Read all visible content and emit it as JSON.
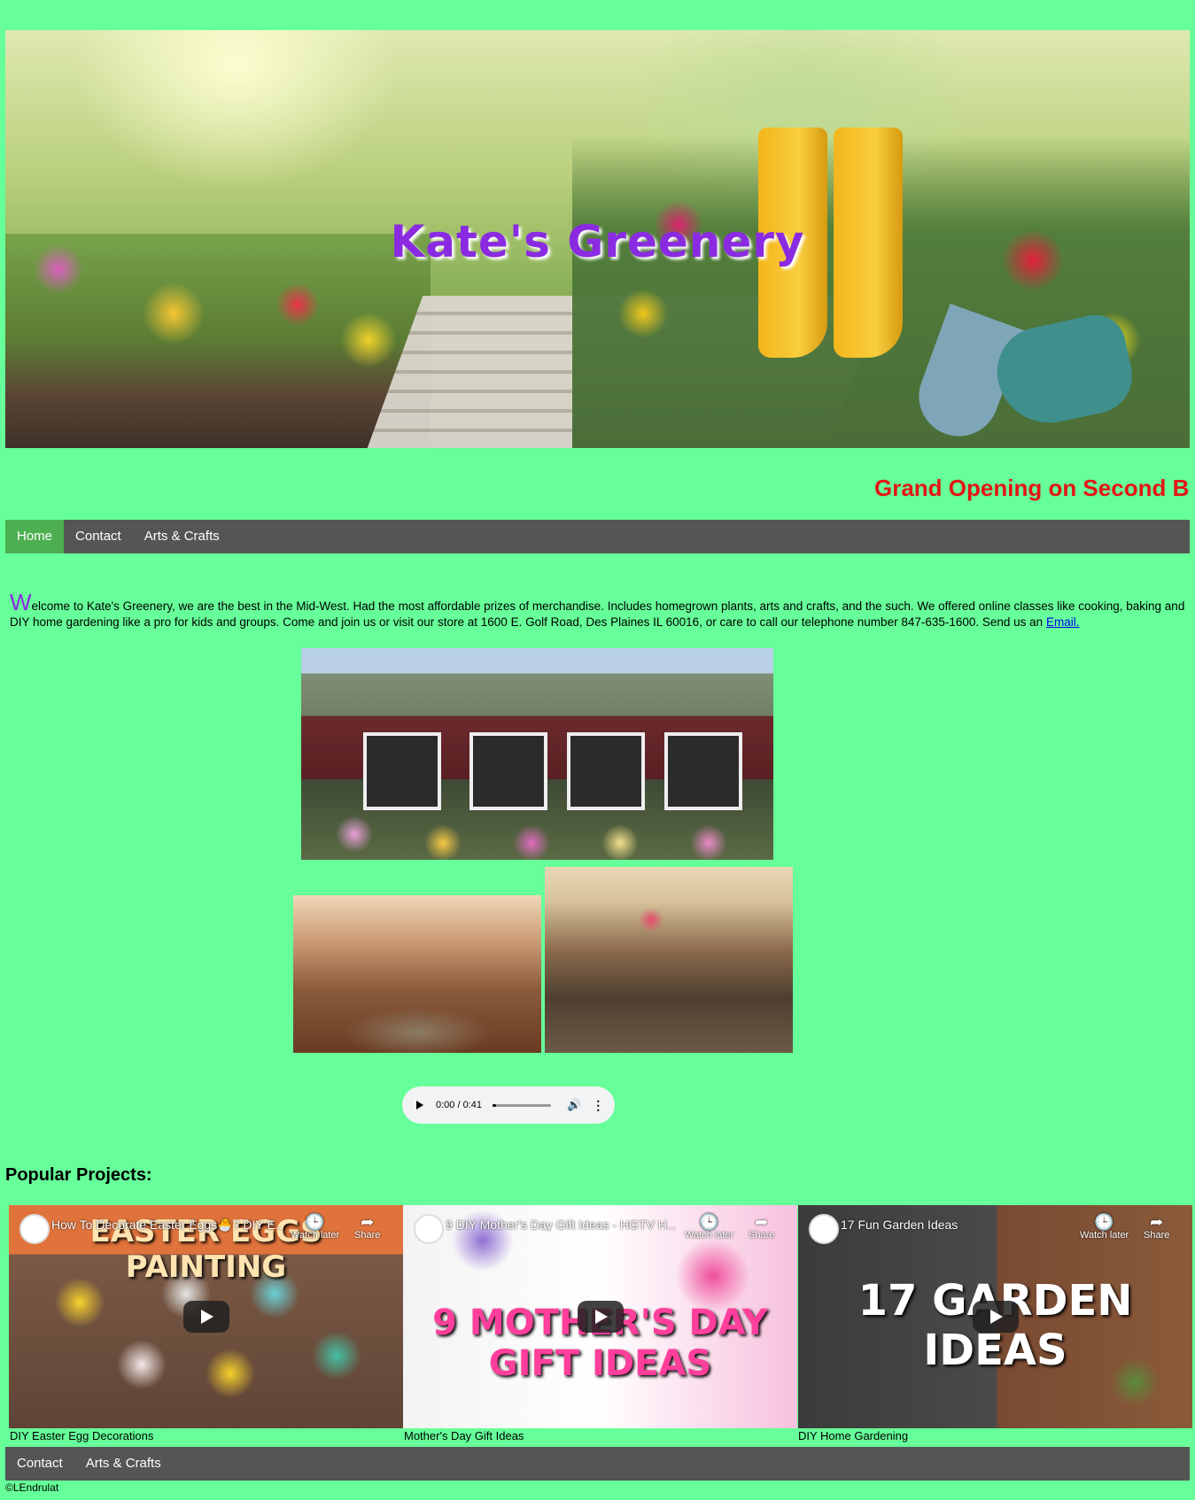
{
  "header": {
    "title": "Kate's Greenery",
    "marquee": "Grand Opening on Second Br"
  },
  "nav": {
    "items": [
      {
        "label": "Home",
        "active": true
      },
      {
        "label": "Contact",
        "active": false
      },
      {
        "label": "Arts & Crafts",
        "active": false
      }
    ]
  },
  "intro": {
    "drop_cap": "W",
    "text": "elcome to Kate's Greenery, we are the best in the Mid-West. Had the most affordable prizes of merchandise. Includes homegrown plants, arts and crafts, and the such. We offered online classes like cooking, baking and DIY home gardening like a pro for kids and groups. Come and join us or visit our store at 1600 E. Golf Road, Des Plaines IL 60016, or care to call our telephone number 847-635-1600. Send us an ",
    "email_link": "Email."
  },
  "audio": {
    "time": "0:00 / 0:41",
    "progress": 0
  },
  "popular": {
    "title": "Popular Projects:",
    "videos": [
      {
        "overlay_title": "How To Decorate Easter Eggs🐣? DIY E...",
        "thumb_text": "EASTER EGGS PAINTING",
        "watch_later": "Watch later",
        "share": "Share",
        "caption": "DIY Easter Egg Decorations"
      },
      {
        "overlay_title": "9 DIY Mother's Day Gift Ideas - HGTV H...",
        "thumb_text": "9 MOTHER'S DAY GIFT IDEAS",
        "watch_later": "Watch later",
        "share": "Share",
        "caption": "Mother's Day Gift Ideas"
      },
      {
        "overlay_title": "17 Fun Garden Ideas",
        "thumb_text": "17 GARDEN IDEAS",
        "watch_later": "Watch later",
        "share": "Share",
        "caption": "DIY Home Gardening"
      }
    ]
  },
  "footer_nav": {
    "items": [
      {
        "label": "Contact"
      },
      {
        "label": "Arts & Crafts"
      }
    ]
  },
  "footer": {
    "copyright": "©LEndrulat"
  },
  "colors": {
    "background": "#66ff99",
    "nav_bg": "#555555",
    "nav_active": "#4caf50",
    "title": "#8a2be2",
    "marquee": "#e41414"
  }
}
